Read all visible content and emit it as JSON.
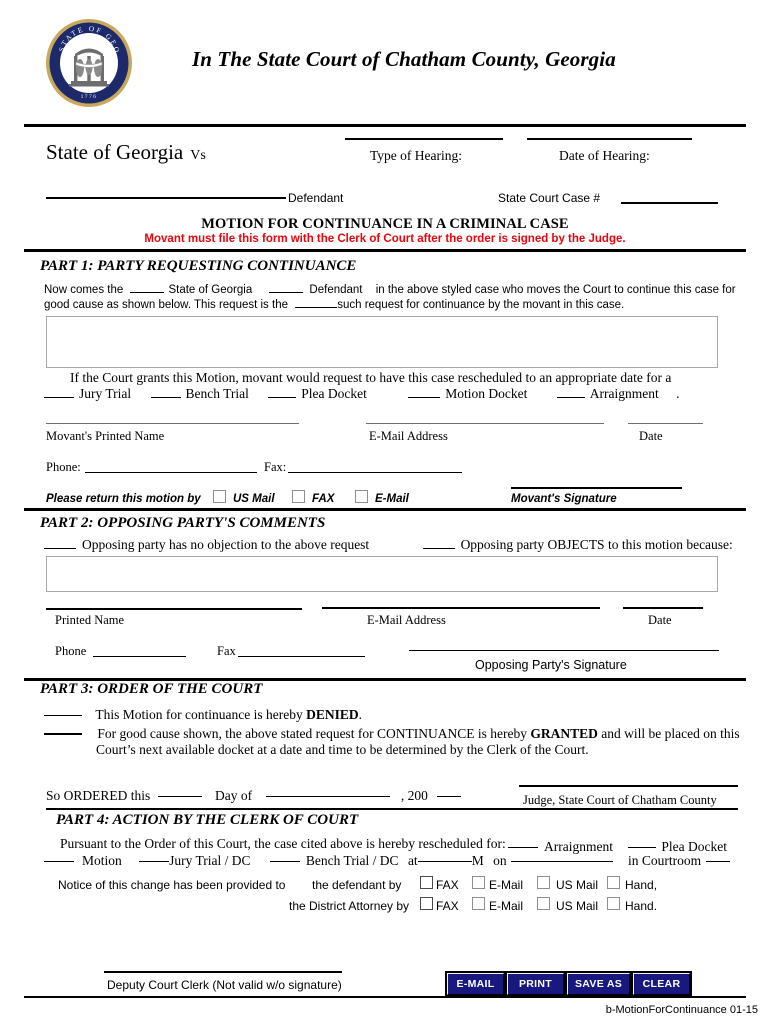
{
  "header": {
    "seal_icon": "georgia-state-seal-icon",
    "seal_text_top": "STATE OF GEORGIA",
    "seal_year": "1776",
    "court_title": "In The State Court of Chatham County, Georgia"
  },
  "caption": {
    "plaintiff": "State of Georgia",
    "vs": "Vs",
    "defendant_label": "Defendant",
    "type_of_hearing_label": "Type of Hearing:",
    "date_of_hearing_label": "Date of Hearing:",
    "case_number_label": "State Court Case #"
  },
  "motion": {
    "title": "MOTION FOR CONTINUANCE IN A CRIMINAL CASE",
    "warning": "Movant must file this form with the Clerk of Court after the order is signed by the Judge.",
    "warning_color": "#e8050b"
  },
  "part1": {
    "heading": "PART 1:  PARTY REQUESTING CONTINUANCE",
    "line1_a": "Now comes the",
    "line1_b": "State of Georgia",
    "line1_c": "Defendant",
    "line1_d": "in the above styled case who moves the Court to continue this case for",
    "line2_a": "good cause as shown below.  This request is the",
    "line2_b": "such request for continuance by the movant in this case.",
    "reason_value": "",
    "reschedule_text": "If the Court grants this Motion, movant would request to have this case rescheduled to an appropriate date for a",
    "options": [
      "Jury Trial",
      "Bench Trial",
      "Plea Docket",
      "Motion Docket",
      "Arraignment"
    ],
    "options_trailing": ".",
    "movant_printed_name_label": "Movant's Printed Name",
    "movant_printed_name_value": "",
    "email_label": "E-Mail Address",
    "email_value": "",
    "date_label": "Date",
    "date_value": "",
    "phone_label": "Phone:",
    "phone_value": "",
    "fax_label": "Fax:",
    "fax_value": "",
    "return_by_label": "Please return this motion by",
    "return_methods": [
      "US Mail",
      "FAX",
      "E-Mail"
    ],
    "signature_label": "Movant's Signature"
  },
  "part2": {
    "heading": "PART 2: OPPOSING PARTY'S COMMENTS",
    "no_objection": "Opposing party has no objection to the above request",
    "objects": "Opposing party OBJECTS to this motion because:",
    "comments_value": "",
    "printed_name_label": "Printed Name",
    "printed_name_value": "",
    "email_label": "E-Mail Address",
    "email_value": "",
    "date_label": "Date",
    "date_value": "",
    "phone_label": "Phone",
    "phone_value": "",
    "fax_label": "Fax",
    "fax_value": "",
    "signature_label": "Opposing Party's Signature"
  },
  "part3": {
    "heading": "PART 3: ORDER OF THE COURT",
    "denied_pre": "This Motion for continuance is hereby ",
    "denied_word": "DENIED",
    "denied_post": ".",
    "granted_pre": "For good cause shown, the above stated request for CONTINUANCE is hereby ",
    "granted_word": "GRANTED",
    "granted_post": " and will be placed on this",
    "granted_line2": "Court’s next available docket at a date and time to be determined by the Clerk of the Court.",
    "so_ordered": "So ORDERED this",
    "day_of": "Day of",
    "year_prefix": ", 200",
    "judge_label": "Judge, State Court of Chatham County"
  },
  "part4": {
    "heading": "PART 4: ACTION BY THE CLERK OF COURT",
    "pursuant": "Pursuant to the Order of this Court, the case cited above is hereby rescheduled for:",
    "arraignment": "Arraignment",
    "plea_docket": "Plea Docket",
    "motion": "Motion",
    "jury_trial": "Jury Trial / DC",
    "bench_trial": "Bench Trial / DC",
    "at": "at",
    "meridiem": "M",
    "on": "on",
    "in_courtroom": "in Courtroom",
    "notice_text": "Notice of this change has been provided to",
    "defendant_by": "the defendant by",
    "district_attorney_by": "the District Attorney by",
    "defendant_methods": [
      "FAX",
      "E-Mail",
      "US Mail",
      "Hand,"
    ],
    "da_methods": [
      "FAX",
      "E-Mail",
      "US Mail",
      "Hand."
    ]
  },
  "footer": {
    "deputy_clerk_label": "Deputy Court Clerk  (Not valid w/o signature)",
    "buttons": [
      {
        "name": "email",
        "label": "E-MAIL"
      },
      {
        "name": "print",
        "label": "PRINT"
      },
      {
        "name": "save-as",
        "label": "SAVE AS"
      },
      {
        "name": "clear",
        "label": "CLEAR"
      }
    ],
    "button_bg": "#18187f",
    "doc_id": "b-MotionForContinuance  01-15"
  }
}
